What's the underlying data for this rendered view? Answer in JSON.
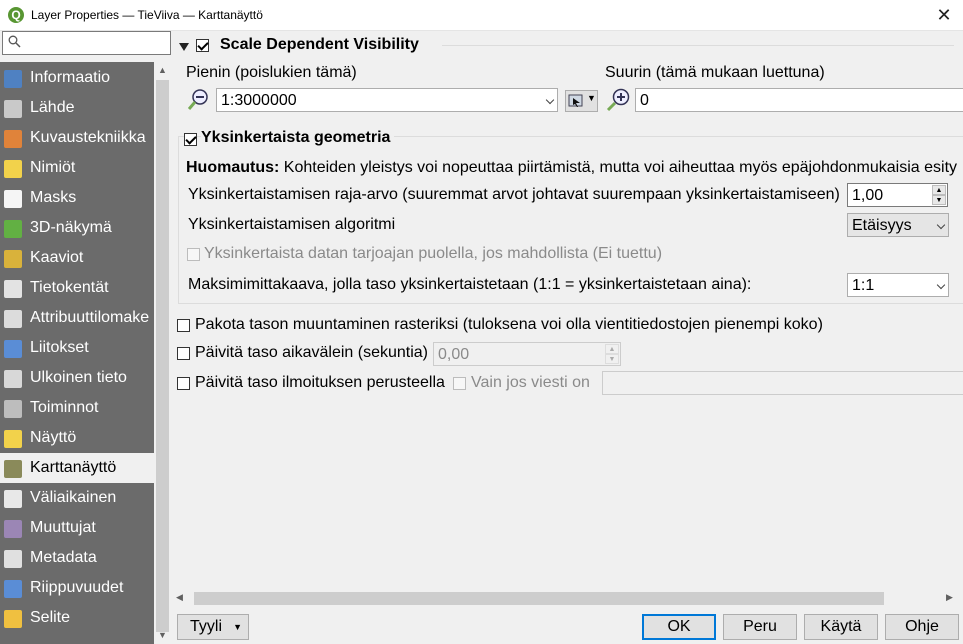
{
  "window": {
    "title": "Layer Properties — TieViiva — Karttanäyttö",
    "close_symbol": "✕",
    "app_icon_letter": "Q"
  },
  "search": {
    "placeholder": "",
    "icon": "search-icon"
  },
  "sidebar": {
    "items": [
      {
        "label": "Informaatio",
        "icon": "info-icon",
        "color": "#4f81c2"
      },
      {
        "label": "Lähde",
        "icon": "source-wrench-icon",
        "color": "#c9c9c9"
      },
      {
        "label": "Kuvaustekniikka",
        "icon": "symbology-brush-icon",
        "color": "#e0833a"
      },
      {
        "label": "Nimiöt",
        "icon": "labels-abc-icon",
        "color": "#f2d24b"
      },
      {
        "label": "Masks",
        "icon": "masks-abc-icon",
        "color": "#f5f5f5"
      },
      {
        "label": "3D-näkymä",
        "icon": "3d-cube-icon",
        "color": "#62b043"
      },
      {
        "label": "Kaaviot",
        "icon": "diagram-icon",
        "color": "#d9b23b"
      },
      {
        "label": "Tietokentät",
        "icon": "fields-icon",
        "color": "#e3e3e3"
      },
      {
        "label": "Attribuuttilomake",
        "icon": "form-icon",
        "color": "#dcdcdc"
      },
      {
        "label": "Liitokset",
        "icon": "joins-icon",
        "color": "#5a8dd6"
      },
      {
        "label": "Ulkoinen tieto",
        "icon": "auxiliary-storage-icon",
        "color": "#d8d8d8"
      },
      {
        "label": "Toiminnot",
        "icon": "actions-gear-icon",
        "color": "#bdbdbd"
      },
      {
        "label": "Näyttö",
        "icon": "display-speech-icon",
        "color": "#f2d24b"
      },
      {
        "label": "Karttanäyttö",
        "icon": "rendering-brush-icon",
        "color": "#8a8a5a"
      },
      {
        "label": "Väliaikainen",
        "icon": "temporal-clock-icon",
        "color": "#e8e8e8"
      },
      {
        "label": "Muuttujat",
        "icon": "variables-icon",
        "color": "#9b86b5"
      },
      {
        "label": "Metadata",
        "icon": "metadata-icon",
        "color": "#e0e0e0"
      },
      {
        "label": "Riippuvuudet",
        "icon": "dependencies-icon",
        "color": "#5a8dd6"
      },
      {
        "label": "Selite",
        "icon": "legend-icon",
        "color": "#f0c040"
      }
    ],
    "selected_index": 13
  },
  "scale_visibility": {
    "title": "Scale Dependent Visibility",
    "checked": true,
    "min_label": "Pienin (poislukien tämä)",
    "min_value": "1:3000000",
    "max_label": "Suurin (tämä mukaan luettuna)",
    "max_value": "0"
  },
  "simplify": {
    "title": "Yksinkertaista geometria",
    "checked": true,
    "note_bold": "Huomautus:",
    "note_text": " Kohteiden yleistys voi nopeuttaa piirtämistä, mutta voi aiheuttaa myös epäjohdonmukaisia esity",
    "threshold_label": "Yksinkertaistamisen raja-arvo (suuremmat arvot johtavat suurempaan yksinkertaistamiseen)",
    "threshold_value": "1,00",
    "algorithm_label": "Yksinkertaistamisen algoritmi",
    "algorithm_value": "Etäisyys",
    "provider_label": "Yksinkertaista datan tarjoajan puolella, jos mahdollista (Ei tuettu)",
    "provider_checked": false,
    "max_scale_label": "Maksimimittakaava, jolla taso yksinkertaistetaan (1:1 = yksinkertaistetaan aina):",
    "max_scale_value": "1:1"
  },
  "other_options": {
    "raster_label": "Pakota tason muuntaminen rasteriksi (tuloksena voi olla vientitiedostojen pienempi koko)",
    "raster_checked": false,
    "refresh_label": "Päivitä taso aikavälein (sekuntia)",
    "refresh_checked": false,
    "refresh_value": "0,00",
    "notify_label": "Päivitä taso ilmoituksen perusteella",
    "notify_checked": false,
    "only_if_label": "Vain jos viesti on",
    "only_if_value": ""
  },
  "footer": {
    "style_label": "Tyyli",
    "ok_label": "OK",
    "cancel_label": "Peru",
    "apply_label": "Käytä",
    "help_label": "Ohje"
  }
}
